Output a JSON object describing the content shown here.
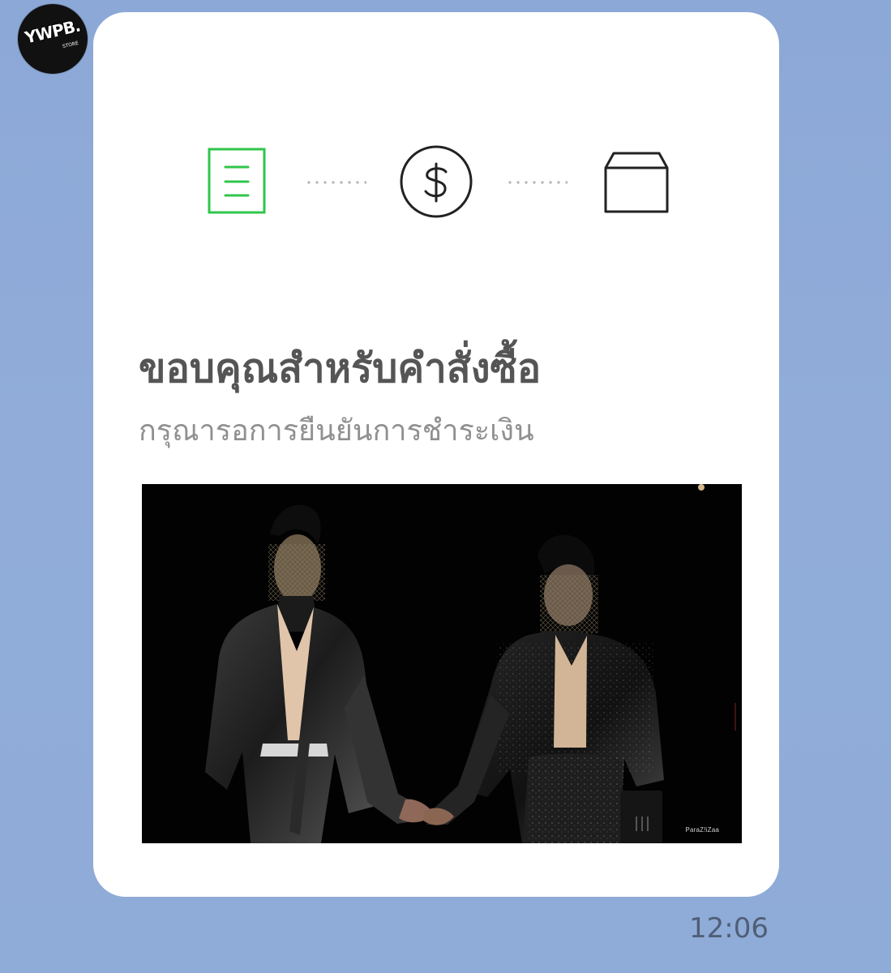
{
  "chat": {
    "avatar_text": "YWPB.",
    "avatar_subtext": "STORE",
    "timestamp": "12:06"
  },
  "message": {
    "title": "ขอบคุณสำหรับคำสั่งซื้อ",
    "subtitle": "กรุณารอการยืนยันการชำระเงิน",
    "photo_watermark": "ParaZ!iZaa"
  },
  "progress": {
    "steps": [
      {
        "icon": "order-list-icon",
        "status": "active"
      },
      {
        "icon": "dollar-circle-icon",
        "status": "inactive"
      },
      {
        "icon": "package-box-icon",
        "status": "inactive"
      }
    ]
  },
  "colors": {
    "background": "#8eaad6",
    "card": "#ffffff",
    "active_green": "#2fc64b",
    "inactive_icon": "#222222",
    "title_text": "#555555",
    "subtitle_text": "#909090"
  }
}
